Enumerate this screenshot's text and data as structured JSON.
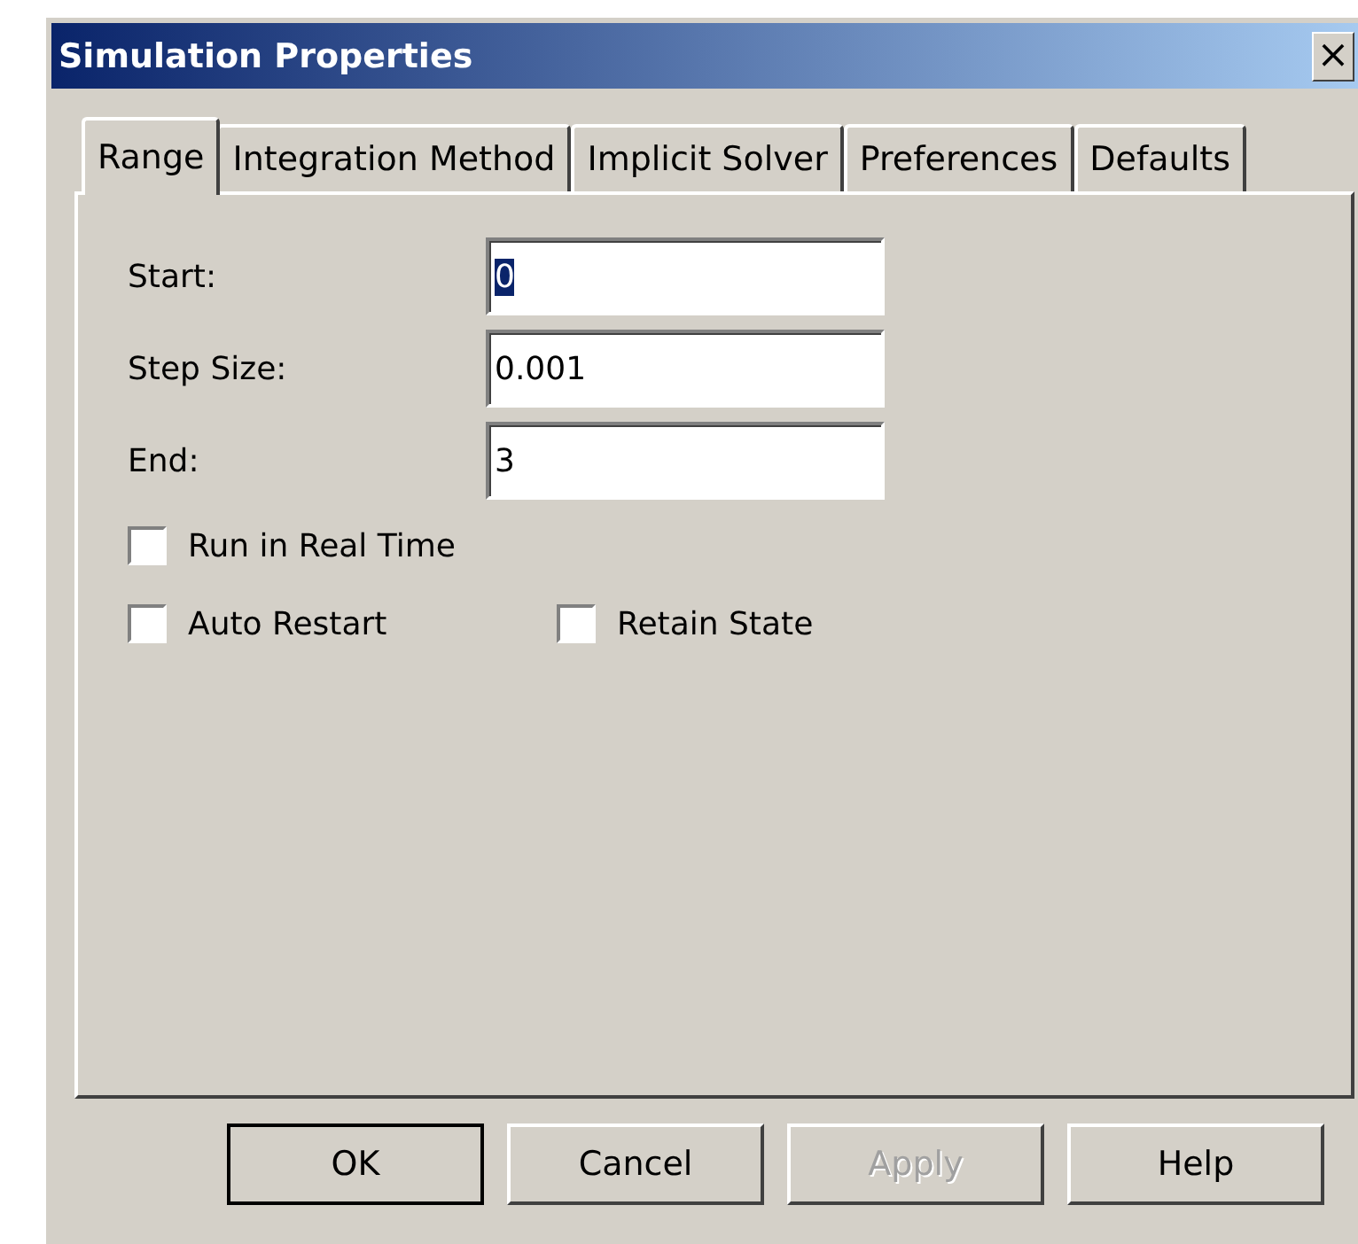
{
  "window": {
    "title": "Simulation Properties",
    "close": "×"
  },
  "tabs": [
    {
      "label": "Range",
      "selected": true
    },
    {
      "label": "Integration Method",
      "selected": false
    },
    {
      "label": "Implicit Solver",
      "selected": false
    },
    {
      "label": "Preferences",
      "selected": false
    },
    {
      "label": "Defaults",
      "selected": false
    }
  ],
  "fields": [
    {
      "label": "Start:",
      "value": "0",
      "text_selected": true
    },
    {
      "label": "Step Size:",
      "value": "0.001",
      "text_selected": false
    },
    {
      "label": "End:",
      "value": "3",
      "text_selected": false
    }
  ],
  "checkbox_rows": [
    [
      {
        "label": "Run in Real Time",
        "checked": false
      }
    ],
    [
      {
        "label": "Auto Restart",
        "checked": false
      },
      {
        "label": "Retain State",
        "checked": false
      }
    ]
  ],
  "buttons": [
    {
      "label": "OK",
      "default": true,
      "disabled": false
    },
    {
      "label": "Cancel",
      "default": false,
      "disabled": false
    },
    {
      "label": "Apply",
      "default": false,
      "disabled": true
    },
    {
      "label": "Help",
      "default": false,
      "disabled": false
    }
  ]
}
